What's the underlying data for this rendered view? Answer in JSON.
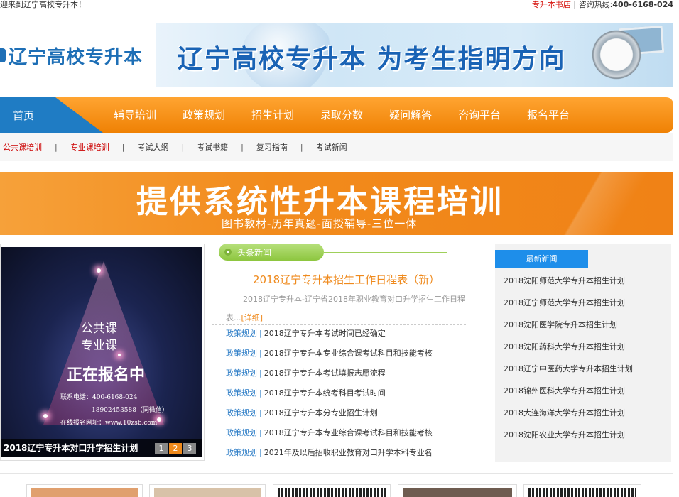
{
  "topbar": {
    "welcome": "迎来到辽宁高校专升本！",
    "shop": "专升本书店",
    "divider": "|",
    "hotline_label": "咨询热线:",
    "hotline_number": "400-6168-024"
  },
  "logo": {
    "text": "辽宁高校专升本"
  },
  "banner": {
    "slogan": "辽宁高校专升本  为考生指明方向"
  },
  "nav": {
    "home": "首页",
    "items": [
      "辅导培训",
      "政策规划",
      "招生计划",
      "录取分数",
      "疑问解答",
      "咨询平台",
      "报名平台"
    ]
  },
  "subnav": {
    "items": [
      "公共课培训",
      "专业课培训",
      "考试大纲",
      "考试书籍",
      "复习指南",
      "考试新闻"
    ],
    "sep": "|"
  },
  "promo": {
    "title": "提供系统性升本课程培训",
    "subtitle": "图书教材-历年真题-面授辅导-三位一体"
  },
  "slider": {
    "line1": "公共课",
    "line2": "专业课",
    "line3": "正在报名中",
    "line4": "联系电话：400-6168-024",
    "line5": "18902453588（同微信）",
    "line6": "在线报名网址：www.10zsb.com",
    "caption": "2018辽宁专升本对口升学招生计划",
    "dots": [
      "1",
      "2",
      "3"
    ]
  },
  "news": {
    "header": "头条新闻",
    "headline": "2018辽宁专升本招生工作日程表（新）",
    "summary": "2018辽宁专升本-辽宁省2018年职业教育对口升学招生工作日程表...",
    "more": "[详细]",
    "items": [
      {
        "cat": "政策规划",
        "title": "2018辽宁专升本考试时间已经确定"
      },
      {
        "cat": "政策规划",
        "title": "2018辽宁专升本专业综合课考试科目和技能考核"
      },
      {
        "cat": "政策规划",
        "title": "2018辽宁专升本考试填报志愿流程"
      },
      {
        "cat": "政策规划",
        "title": "2018辽宁专升本统考科目考试时间"
      },
      {
        "cat": "政策规划",
        "title": "2018辽宁专升本分专业招生计划"
      },
      {
        "cat": "政策规划",
        "title": "2018辽宁专升本专业综合课考试科目和技能考核"
      },
      {
        "cat": "政策规划",
        "title": "2021年及以后招收职业教育对口升学本科专业名"
      }
    ]
  },
  "latest": {
    "tab": "最新新闻",
    "items": [
      "2018沈阳师范大学专升本招生计划",
      "2018辽宁师范大学专升本招生计划",
      "2018沈阳医学院专升本招生计划",
      "2018沈阳药科大学专升本招生计划",
      "2018辽宁中医药大学专升本招生计划",
      "2018锦州医科大学专升本招生计划",
      "2018大连海洋大学专升本招生计划",
      "2018沈阳农业大学专升本招生计划"
    ]
  },
  "colors": {
    "brand_blue": "#1e6fb6",
    "nav_orange": "#f08a1c",
    "link_blue": "#2b7cc6",
    "accent_red": "#d7140e"
  }
}
